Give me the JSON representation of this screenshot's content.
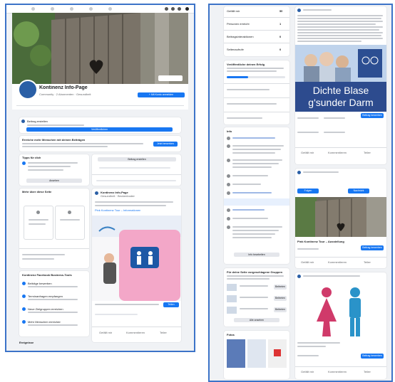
{
  "left": {
    "page_name": "Kontinenz Info-Page",
    "likes_line": "Community · 2 Abonnenten · Gesundheit",
    "create_button": "+ Mit Konto anmelden",
    "post_prompt": "Beitrag erstellen",
    "post_button": "Veröffentlichen",
    "boost_title": "Erreiche mehr Menschen mit deinen Beiträgen",
    "boost_button": "Jetzt bewerben",
    "section_resources": "Kontinenz Facebook Business-Tools",
    "resources": [
      "Beiträge bewerben",
      "Terminanfragen empfangen",
      "Neue Zielgruppen erreichen",
      "Mehr Menschen erreichen"
    ],
    "footer": "Ereignisse",
    "feed_author": "Kontinenz Info-Page",
    "feed_sub": "Gesundheit · Beckenboden",
    "ad_title": "Pink Kontinenz Tour – Informationen",
    "action_like": "Gefällt mir",
    "action_comment": "Kommentieren",
    "action_share": "Teilen",
    "share_button": "Teilen"
  },
  "right": {
    "stats": [
      {
        "label": "Gefällt mir",
        "value": "55"
      },
      {
        "label": "Personen erreicht",
        "value": "1"
      },
      {
        "label": "Beitragsinteraktionen",
        "value": "0"
      },
      {
        "label": "Seitenaufrufe",
        "value": "0"
      }
    ],
    "section_grow": "Veröffentliche deinen Erfolg",
    "section_info": "Info",
    "section_groups": "Für deine Seite vorgeschlagene Gruppen",
    "section_photos": "Fotos",
    "banner_line1": "Dichte Blase",
    "banner_line2": "g'sunder Darm",
    "boost_button": "Beitrag bewerben",
    "card_title": "Pink Kontinenz Tour – Ausstellung",
    "join_label": "Beitreten",
    "action_like": "Gefällt mir",
    "action_comment": "Kommentieren",
    "action_share": "Teilen"
  }
}
